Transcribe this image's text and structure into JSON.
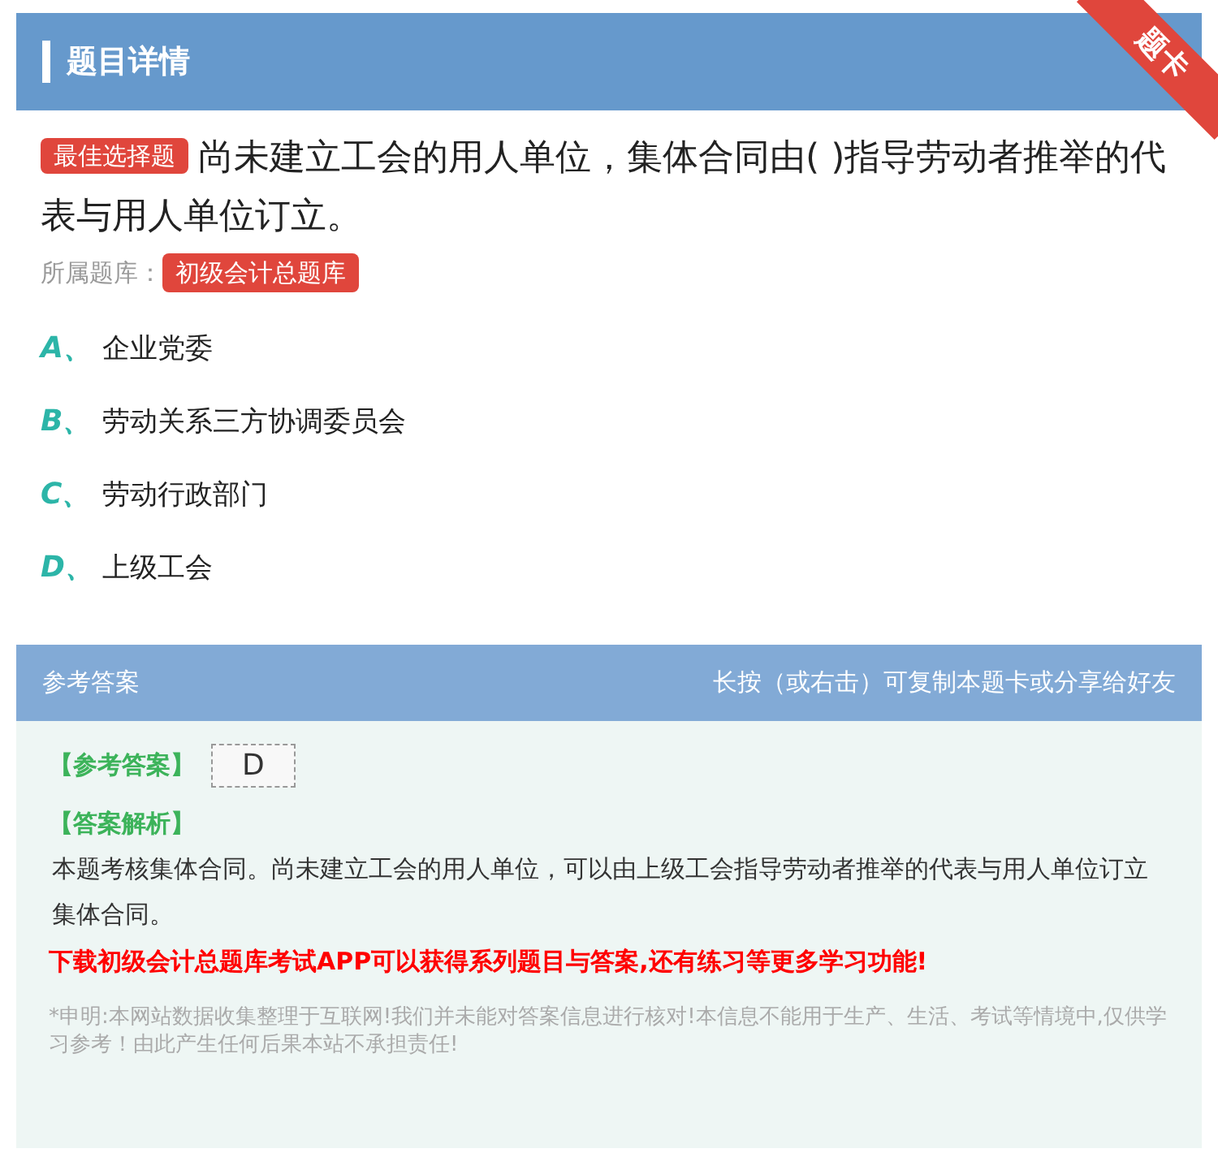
{
  "header": {
    "title": "题目详情",
    "ribbon": "题卡"
  },
  "question": {
    "type_badge": "最佳选择题",
    "text": "尚未建立工会的用人单位，集体合同由( )指导劳动者推举的代表与用人单位订立。",
    "bank_label": "所属题库：",
    "bank": "初级会计总题库"
  },
  "options": [
    {
      "letter": "A、",
      "text": "企业党委"
    },
    {
      "letter": "B、",
      "text": "劳动关系三方协调委员会"
    },
    {
      "letter": "C、",
      "text": "劳动行政部门"
    },
    {
      "letter": "D、",
      "text": "上级工会"
    }
  ],
  "answer_panel": {
    "title": "参考答案",
    "hint": "长按（或右击）可复制本题卡或分享给好友",
    "answer_label": "【参考答案】",
    "answer": "D",
    "analysis_label": "【答案解析】",
    "analysis": "本题考核集体合同。尚未建立工会的用人单位，可以由上级工会指导劳动者推举的代表与用人单位订立集体合同。",
    "promo": "下载初级会计总题库考试APP可以获得系列题目与答案,还有练习等更多学习功能!",
    "disclaimer": "*申明:本网站数据收集整理于互联网!我们并未能对答案信息进行核对!本信息不能用于生产、生活、考试等情境中,仅供学习参考！由此产生任何后果本站不承担责任!"
  }
}
